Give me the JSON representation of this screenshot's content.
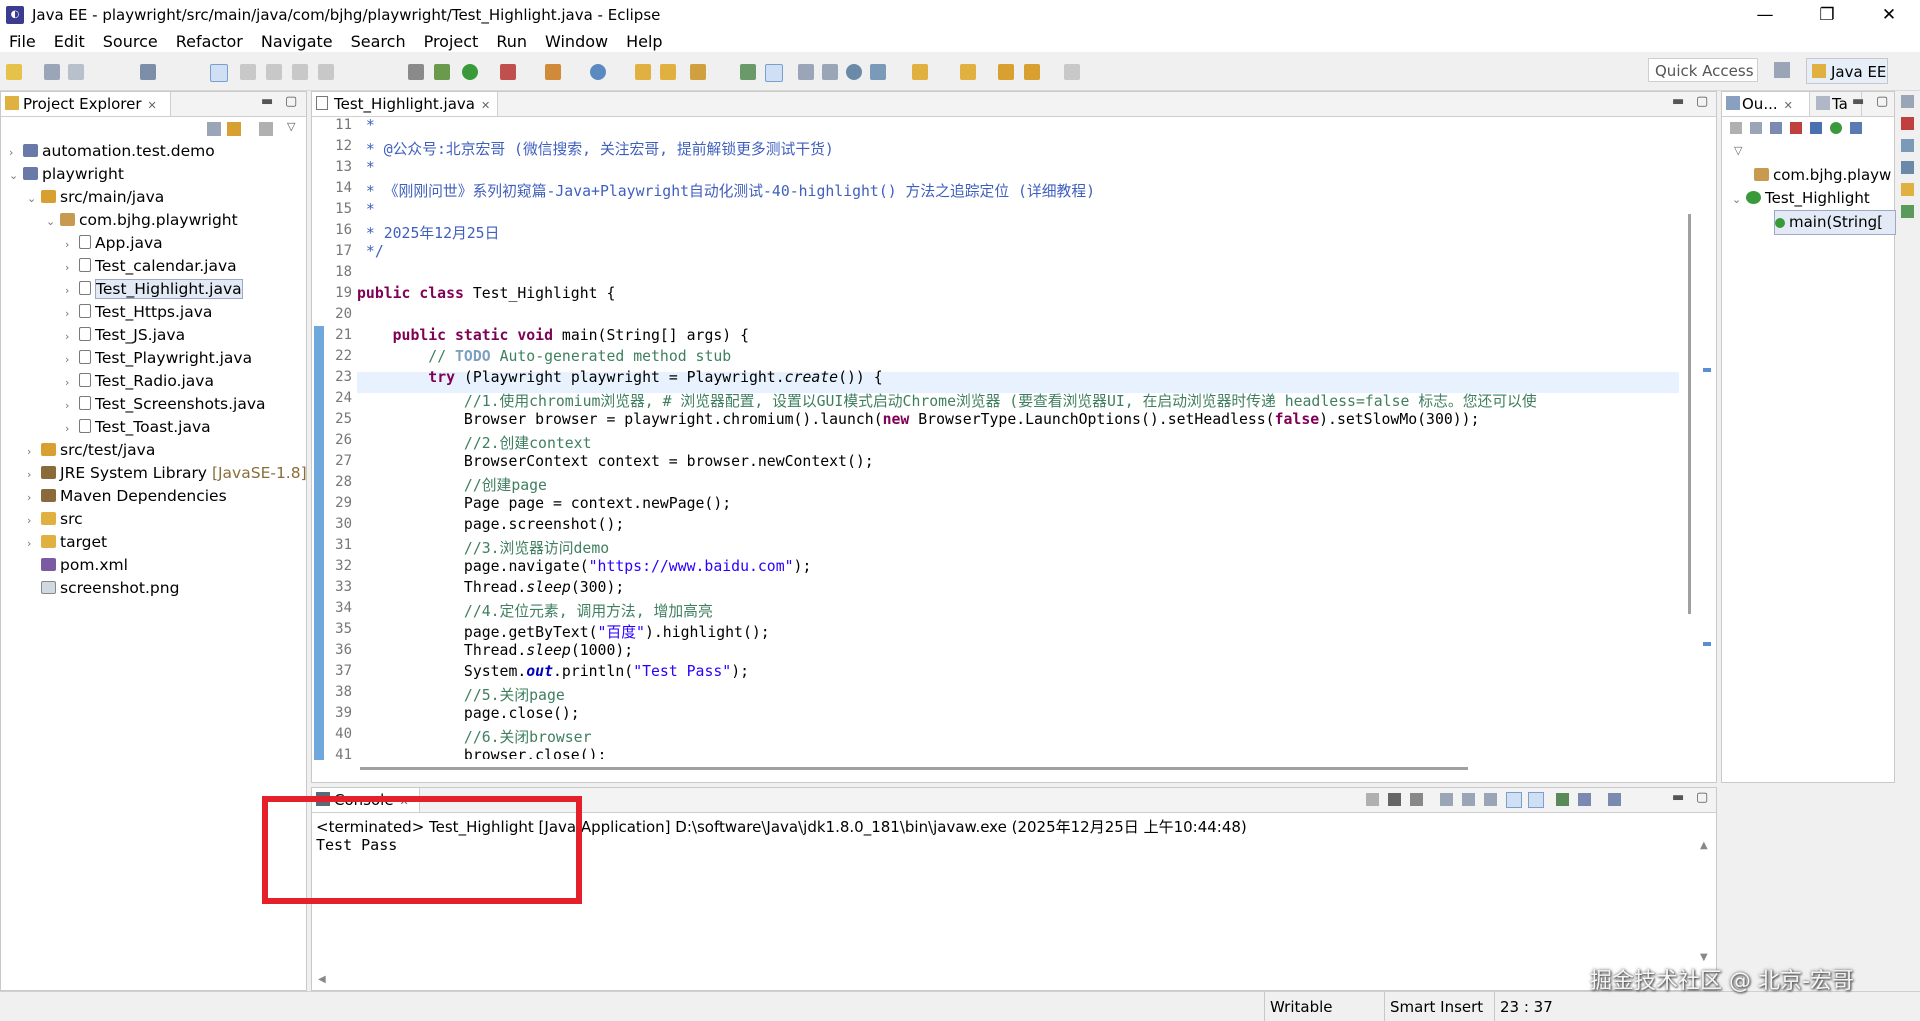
{
  "window": {
    "title": "Java EE - playwright/src/main/java/com/bjhg/playwright/Test_Highlight.java - Eclipse",
    "app_icon": "eclipse-icon"
  },
  "menu": [
    "File",
    "Edit",
    "Source",
    "Refactor",
    "Navigate",
    "Search",
    "Project",
    "Run",
    "Window",
    "Help"
  ],
  "toolbar": {
    "quick_access": "Quick Access",
    "perspective": "Java EE"
  },
  "explorer": {
    "tab": "Project Explorer",
    "items": [
      {
        "label": "automation.test.demo"
      },
      {
        "label": "playwright"
      },
      {
        "label": "src/main/java"
      },
      {
        "label": "com.bjhg.playwright"
      },
      {
        "label": "App.java"
      },
      {
        "label": "Test_calendar.java"
      },
      {
        "label": "Test_Highlight.java"
      },
      {
        "label": "Test_Https.java"
      },
      {
        "label": "Test_JS.java"
      },
      {
        "label": "Test_Playwright.java"
      },
      {
        "label": "Test_Radio.java"
      },
      {
        "label": "Test_Screenshots.java"
      },
      {
        "label": "Test_Toast.java"
      },
      {
        "label": "src/test/java"
      },
      {
        "label": "JRE System Library",
        "extra": "[JavaSE-1.8]"
      },
      {
        "label": "Maven Dependencies"
      },
      {
        "label": "src"
      },
      {
        "label": "target"
      },
      {
        "label": "pom.xml"
      },
      {
        "label": "screenshot.png"
      }
    ]
  },
  "editor": {
    "tab": "Test_Highlight.java",
    "line_numbers": [
      "11",
      "12",
      "13",
      "14",
      "15",
      "16",
      "17",
      "18",
      "19",
      "20",
      "21",
      "22",
      "23",
      "24",
      "25",
      "26",
      "27",
      "28",
      "29",
      "30",
      "31",
      "32",
      "33",
      "34",
      "35",
      "36",
      "37",
      "38",
      "39",
      "40",
      "41"
    ]
  },
  "code": {
    "l11": " *",
    "l12": " * @公众号:北京宏哥 (微信搜索, 关注宏哥, 提前解锁更多测试干货)",
    "l13": " *",
    "l14": " * 《刚刚问世》系列初窥篇-Java+Playwright自动化测试-40-highlight() 方法之追踪定位 (详细教程)",
    "l15": " *",
    "l16": " * 2025年12月25日",
    "l17": " */",
    "public_class": "public class",
    "class_name": " Test_Highlight {",
    "indent21": "    ",
    "public_static_void": "public static void",
    "main_sig": " main(String[] args) {",
    "indent22": "        ",
    "comment22a": "// ",
    "todo": "TODO",
    "comment22b": " Auto-generated method stub",
    "try": "try",
    "try_a": " (Playwright playwright = Playwright.",
    "create": "create",
    "try_b": "()) {",
    "indent12": "            ",
    "l24": "//1.使用chromium浏览器, # 浏览器配置, 设置以GUI模式启动Chrome浏览器 (要查看浏览器UI, 在启动浏览器时传递 headless=false 标志。您还可以使",
    "l25a": "Browser browser = playwright.chromium().launch(",
    "new": "new",
    "l25b": " BrowserType.LaunchOptions().setHeadless(",
    "false": "false",
    "l25c": ").setSlowMo(300));",
    "l26": "//2.创建context",
    "l27": "BrowserContext context = browser.newContext();",
    "l28": "//创建page",
    "l29": "Page page = context.newPage();",
    "l30": "page.screenshot();",
    "l31": "//3.浏览器访问demo",
    "l32a": "page.navigate(",
    "url": "\"https://www.baidu.com\"",
    "l32b": ");",
    "l33a": "Thread.",
    "sleep": "sleep",
    "l33b": "(300);",
    "l34": "//4.定位元素, 调用方法, 增加高亮",
    "l35a": "page.getByText(",
    "baidu": "\"百度\"",
    "l35b": ").highlight();",
    "l36b": "(1000);",
    "l37a": "System.",
    "out": "out",
    "l37b": ".println(",
    "test_pass_str": "\"Test Pass\"",
    "l38": "//5.关闭page",
    "l39": "page.close();",
    "l40": "//6.关闭browser",
    "l41": "browser.close();"
  },
  "outline": {
    "tab1": "Ou...",
    "tab2": "Ta",
    "items": [
      "com.bjhg.playw",
      "Test_Highlight",
      "main(String["
    ]
  },
  "console": {
    "tab": "Console",
    "header": "<terminated> Test_Highlight [Java Application] D:\\software\\Java\\jdk1.8.0_181\\bin\\javaw.exe (2025年12月25日 上午10:44:48)",
    "output": "Test Pass"
  },
  "status": {
    "writable": "Writable",
    "insert": "Smart Insert",
    "position": "23 : 37"
  },
  "watermark": "掘金技术社区 @ 北京-宏哥",
  "colors": {
    "keyword": "#7f0055",
    "comment": "#3f7f5f",
    "string": "#2a00ff",
    "highlight_box": "#e4202a"
  }
}
